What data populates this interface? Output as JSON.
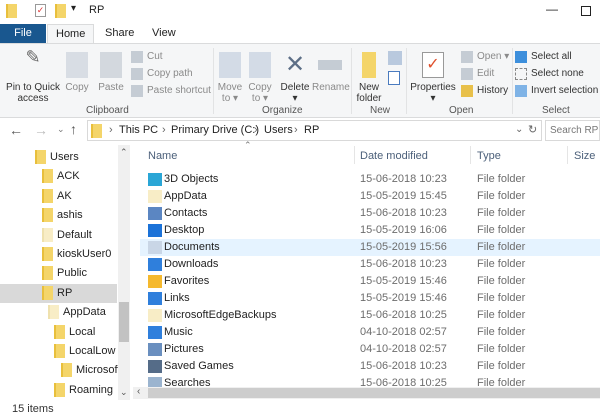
{
  "title": "RP",
  "tabs": [
    "File",
    "Home",
    "Share",
    "View"
  ],
  "ribbon": {
    "clipboard": {
      "label": "Clipboard",
      "pin": [
        "Pin to Quick",
        "access"
      ],
      "copy": "Copy",
      "paste": "Paste",
      "cut": "Cut",
      "copy_path": "Copy path",
      "paste_shortcut": "Paste shortcut"
    },
    "organize": {
      "label": "Organize",
      "move_to": [
        "Move",
        "to ▾"
      ],
      "copy_to": [
        "Copy",
        "to ▾"
      ],
      "delete": [
        "Delete",
        "▾"
      ],
      "rename": "Rename"
    },
    "new": {
      "label": "New",
      "new_folder": [
        "New",
        "folder"
      ]
    },
    "open": {
      "label": "Open",
      "properties": [
        "Properties",
        "▾"
      ],
      "open": "Open ▾",
      "edit": "Edit",
      "history": "History"
    },
    "select": {
      "label": "Select",
      "select_all": "Select all",
      "select_none": "Select none",
      "invert": "Invert selection"
    }
  },
  "address": {
    "crumbs": [
      "This PC",
      "Primary Drive (C:)",
      "Users",
      "RP"
    ],
    "search_placeholder": "Search RP"
  },
  "tree": [
    {
      "label": "Users",
      "level": 0
    },
    {
      "label": "ACK",
      "level": 1
    },
    {
      "label": "AK",
      "level": 1
    },
    {
      "label": "ashis",
      "level": 1
    },
    {
      "label": "Default",
      "level": 1
    },
    {
      "label": "kioskUser0",
      "level": 1
    },
    {
      "label": "Public",
      "level": 1
    },
    {
      "label": "RP",
      "level": 1,
      "selected": true
    },
    {
      "label": "AppData",
      "level": 2
    },
    {
      "label": "Local",
      "level": 3
    },
    {
      "label": "LocalLow",
      "level": 3
    },
    {
      "label": "Microsoft",
      "level": 4
    },
    {
      "label": "Roaming",
      "level": 3
    }
  ],
  "columns": [
    "Name",
    "Date modified",
    "Type",
    "Size"
  ],
  "files": [
    {
      "name": "3D Objects",
      "date": "15-06-2018 10:23",
      "type": "File folder",
      "icon": "3d-objects-icon",
      "color": "#2aa6d6"
    },
    {
      "name": "AppData",
      "date": "15-05-2019 15:45",
      "type": "File folder",
      "icon": "folder-icon",
      "color": "#f8edc6"
    },
    {
      "name": "Contacts",
      "date": "15-06-2018 10:23",
      "type": "File folder",
      "icon": "contacts-icon",
      "color": "#5b86c2"
    },
    {
      "name": "Desktop",
      "date": "15-05-2019 16:06",
      "type": "File folder",
      "icon": "desktop-icon",
      "color": "#1b72d8"
    },
    {
      "name": "Documents",
      "date": "15-05-2019 15:56",
      "type": "File folder",
      "icon": "documents-icon",
      "color": "#c9d6e6",
      "selected": true
    },
    {
      "name": "Downloads",
      "date": "15-06-2018 10:23",
      "type": "File folder",
      "icon": "downloads-icon",
      "color": "#2f7fdc"
    },
    {
      "name": "Favorites",
      "date": "15-05-2019 15:46",
      "type": "File folder",
      "icon": "star-icon",
      "color": "#f5b92e"
    },
    {
      "name": "Links",
      "date": "15-05-2019 15:46",
      "type": "File folder",
      "icon": "links-icon",
      "color": "#2f7fdc"
    },
    {
      "name": "MicrosoftEdgeBackups",
      "date": "15-06-2018 10:25",
      "type": "File folder",
      "icon": "folder-icon",
      "color": "#f8edc6"
    },
    {
      "name": "Music",
      "date": "04-10-2018 02:57",
      "type": "File folder",
      "icon": "music-icon",
      "color": "#2f7fdc"
    },
    {
      "name": "Pictures",
      "date": "04-10-2018 02:57",
      "type": "File folder",
      "icon": "pictures-icon",
      "color": "#6a8fbf"
    },
    {
      "name": "Saved Games",
      "date": "15-06-2018 10:23",
      "type": "File folder",
      "icon": "saved-games-icon",
      "color": "#556c88"
    },
    {
      "name": "Searches",
      "date": "15-06-2018 10:25",
      "type": "File folder",
      "icon": "search-icon",
      "color": "#9bb4cf"
    }
  ],
  "status": "15 items"
}
